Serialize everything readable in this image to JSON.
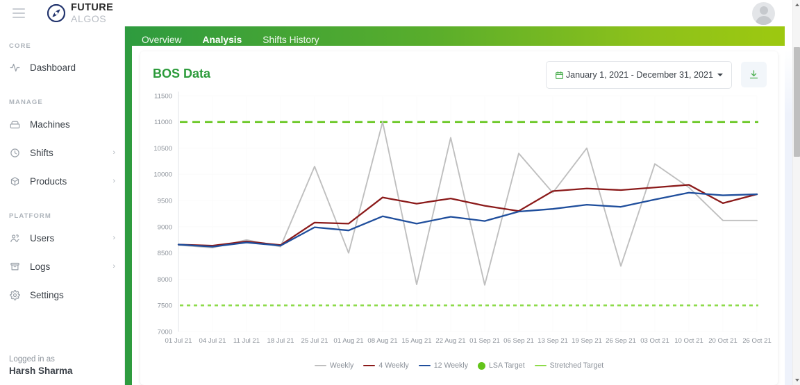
{
  "topbar": {
    "menu_icon": "hamburger-icon",
    "brand_line1": "FUTURE",
    "brand_line2": "ALGOS",
    "avatar_icon": "user-avatar-icon"
  },
  "sidebar": {
    "sections": [
      {
        "label": "CORE",
        "items": [
          {
            "label": "Dashboard",
            "icon": "activity-icon",
            "chevron": ""
          }
        ]
      },
      {
        "label": "MANAGE",
        "items": [
          {
            "label": "Machines",
            "icon": "machine-icon",
            "chevron": ""
          },
          {
            "label": "Shifts",
            "icon": "clock-icon",
            "chevron": "›"
          },
          {
            "label": "Products",
            "icon": "box-icon",
            "chevron": "›"
          }
        ]
      },
      {
        "label": "PLATFORM",
        "items": [
          {
            "label": "Users",
            "icon": "users-icon",
            "chevron": "›"
          },
          {
            "label": "Logs",
            "icon": "archive-icon",
            "chevron": "›"
          },
          {
            "label": "Settings",
            "icon": "gear-icon",
            "chevron": ""
          }
        ]
      }
    ],
    "footer": {
      "logged_label": "Logged in as",
      "user_name": "Harsh Sharma"
    }
  },
  "tabs": [
    {
      "label": "Overview",
      "active": false
    },
    {
      "label": "Analysis",
      "active": true
    },
    {
      "label": "Shifts History",
      "active": false
    }
  ],
  "card": {
    "title": "BOS Data",
    "date_range": "January 1, 2021 - December 31, 2021",
    "calendar_icon": "calendar-icon",
    "caret_icon": "chevron-down-icon",
    "download_icon": "download-icon"
  },
  "colors": {
    "brand_green": "#2c9b3b",
    "header_gradient_start": "#2e9b3f",
    "header_gradient_end": "#9ec90f",
    "weekly": "#bfbfbf",
    "four_weekly": "#8b1a1a",
    "twelve_weekly": "#1f4e9c",
    "lsa_target": "#63c41a",
    "stretched_target": "#8ddb4a"
  },
  "chart_data": {
    "type": "line",
    "title": "BOS Data",
    "xlabel": "",
    "ylabel": "",
    "ylim": [
      7000,
      11500
    ],
    "ytick_step": 500,
    "yticks": [
      7000,
      7500,
      8000,
      8500,
      9000,
      9500,
      10000,
      10500,
      11000,
      11500
    ],
    "grid": true,
    "legend_position": "bottom",
    "x": [
      "01 Jul 21",
      "04 Jul 21",
      "11 Jul 21",
      "18 Jul 21",
      "25 Jul 21",
      "01 Aug 21",
      "08 Aug 21",
      "15 Aug 21",
      "22 Aug 21",
      "01 Sep 21",
      "06 Sep 21",
      "13 Sep 21",
      "19 Sep 21",
      "26 Sep 21",
      "03 Oct 21",
      "10 Oct 21",
      "20 Oct 21",
      "26 Oct 21"
    ],
    "xticks": [
      "01 Jul 21",
      "04 Jul 21",
      "11 Jul 21",
      "18 Jul 21",
      "25 Jul 21",
      "01 Aug 21",
      "08 Aug 21",
      "15 Aug 21",
      "22 Aug 21",
      "01 Sep 21",
      "06 Sep 21",
      "13 Sep 21",
      "19 Sep 21",
      "26 Sep 21",
      "03 Oct 21",
      "10 Oct 21",
      "20 Oct 21",
      "26 Oct 21"
    ],
    "series": [
      {
        "name": "Weekly",
        "color": "#bfbfbf",
        "style": "solid",
        "values": [
          8650,
          8600,
          8750,
          8620,
          10150,
          8500,
          11000,
          7900,
          10700,
          7890,
          10400,
          9650,
          10500,
          8250,
          10200,
          9750,
          9120,
          9120
        ]
      },
      {
        "name": "4 Weekly",
        "color": "#8b1a1a",
        "style": "solid",
        "values": [
          8660,
          8640,
          8720,
          8650,
          9080,
          9060,
          9560,
          9440,
          9540,
          9400,
          9300,
          9680,
          9730,
          9700,
          9750,
          9800,
          9450,
          9620
        ]
      },
      {
        "name": "12 Weekly",
        "color": "#1f4e9c",
        "style": "solid",
        "values": [
          8660,
          8620,
          8700,
          8640,
          8990,
          8930,
          9200,
          9060,
          9190,
          9110,
          9290,
          9340,
          9420,
          9380,
          9520,
          9650,
          9600,
          9620
        ]
      },
      {
        "name": "LSA Target",
        "color": "#63c41a",
        "style": "dashed",
        "constant": 11000
      },
      {
        "name": "Stretched Target",
        "color": "#8ddb4a",
        "style": "dotted",
        "constant": 7500
      }
    ],
    "legend": [
      {
        "label": "Weekly",
        "color": "#bfbfbf",
        "marker": "line"
      },
      {
        "label": "4 Weekly",
        "color": "#8b1a1a",
        "marker": "line"
      },
      {
        "label": "12 Weekly",
        "color": "#1f4e9c",
        "marker": "line"
      },
      {
        "label": "LSA Target",
        "color": "#63c41a",
        "marker": "dot"
      },
      {
        "label": "Stretched Target",
        "color": "#8ddb4a",
        "marker": "line"
      }
    ]
  },
  "scrollbar": {
    "up_icon": "scroll-up-arrow-icon",
    "down_icon": "scroll-down-arrow-icon"
  }
}
